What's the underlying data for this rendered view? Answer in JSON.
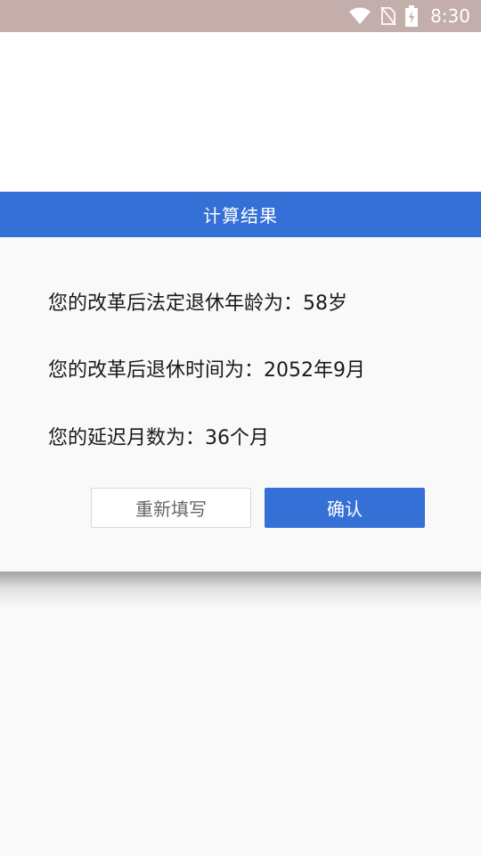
{
  "status_bar": {
    "time": "8:30",
    "icons": [
      "wifi-icon",
      "no-sim-icon",
      "battery-charging-icon"
    ],
    "background": "#c4aeac"
  },
  "dialog": {
    "title": "计算结果",
    "header_color": "#3570d6",
    "lines": [
      "您的改革后法定退休年龄为：58岁",
      "您的改革后退休时间为：2052年9月",
      "您的延迟月数为：36个月"
    ],
    "buttons": {
      "refill": "重新填写",
      "confirm": "确认"
    }
  }
}
